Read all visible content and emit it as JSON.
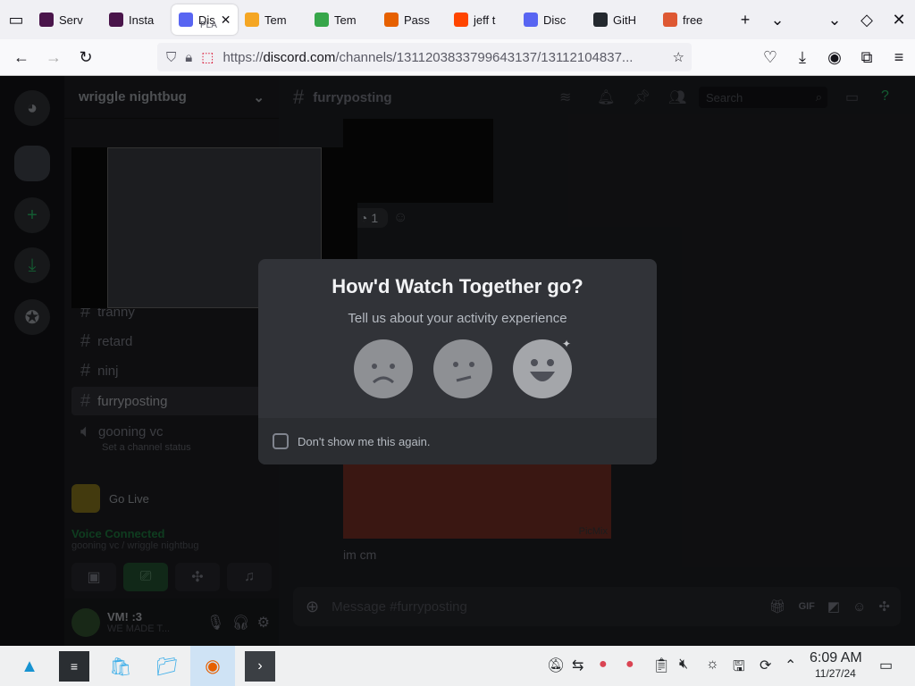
{
  "browser": {
    "tabs": [
      {
        "label": "Serv",
        "icon": "slack-icon",
        "color": "#4a154b"
      },
      {
        "label": "Insta",
        "icon": "slack-icon",
        "color": "#4a154b"
      },
      {
        "label": "Dis",
        "sub": "PLA",
        "icon": "discord-icon",
        "color": "#5865f2",
        "active": true
      },
      {
        "label": "Tem",
        "icon": "mail-icon",
        "color": "#f5a623"
      },
      {
        "label": "Tem",
        "icon": "mail-icon",
        "color": "#37a64a"
      },
      {
        "label": "Pass",
        "icon": "firefox-icon",
        "color": "#e66000"
      },
      {
        "label": "jeff t",
        "icon": "reddit-icon",
        "color": "#ff4500"
      },
      {
        "label": "Disc",
        "icon": "discord-icon",
        "color": "#5865f2"
      },
      {
        "label": "GitH",
        "icon": "github-icon",
        "color": "#24292f"
      },
      {
        "label": "free",
        "icon": "duckduckgo-icon",
        "color": "#de5833"
      }
    ],
    "url_protocol": "https://",
    "url_host": "discord.com",
    "url_path": "/channels/1311203833799643137/13112104837..."
  },
  "discord": {
    "server_name": "wriggle nightbug",
    "channels": [
      "tranny",
      "retard",
      "ninj",
      "furryposting"
    ],
    "selected_channel": "furryposting",
    "voice_channel": "gooning vc",
    "voice_channel_status": "Set a channel status",
    "go_live_label": "Go Live",
    "voice_connected": "Voice Connected",
    "voice_location": "gooning vc / wriggle nightbug",
    "user_name": "VM! :3",
    "user_status": "WE MADE T...",
    "channel_header": "furryposting",
    "search_placeholder": "Search",
    "reaction_count": "1",
    "message_text": "im cm",
    "composer_placeholder": "Message #furryposting",
    "image_watermark": "PicMix"
  },
  "popup": {
    "title": "How'd Watch Together go?",
    "subtitle": "Tell us about your activity experience",
    "checkbox_label": "Don't show me this again."
  },
  "taskbar": {
    "time": "6:09 AM",
    "date": "11/27/24"
  }
}
